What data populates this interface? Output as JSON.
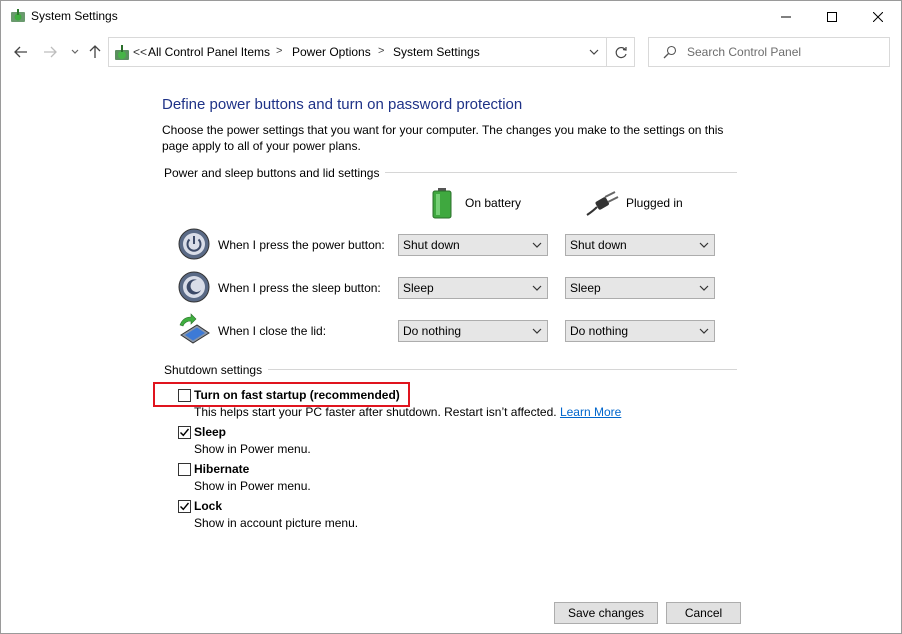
{
  "window": {
    "title": "System Settings",
    "controls": {
      "minimize": "minimize-icon",
      "maximize": "maximize-icon",
      "close": "close-icon"
    }
  },
  "nav": {
    "breadcrumb_overflow": "<<",
    "breadcrumbs": [
      "All Control Panel Items",
      "Power Options",
      "System Settings"
    ],
    "search_placeholder": "Search Control Panel"
  },
  "page": {
    "title": "Define power buttons and turn on password protection",
    "description": "Choose the power settings that you want for your computer. The changes you make to the settings on this page apply to all of your power plans."
  },
  "power_section": {
    "label": "Power and sleep buttons and lid settings",
    "columns": {
      "on_battery": "On battery",
      "plugged_in": "Plugged in"
    },
    "rows": [
      {
        "label": "When I press the power button:",
        "on_battery": "Shut down",
        "plugged_in": "Shut down",
        "icon": "power-button-icon"
      },
      {
        "label": "When I press the sleep button:",
        "on_battery": "Sleep",
        "plugged_in": "Sleep",
        "icon": "sleep-button-icon"
      },
      {
        "label": "When I close the lid:",
        "on_battery": "Do nothing",
        "plugged_in": "Do nothing",
        "icon": "laptop-lid-icon"
      }
    ]
  },
  "shutdown_section": {
    "label": "Shutdown settings",
    "options": [
      {
        "label": "Turn on fast startup (recommended)",
        "checked": false,
        "description": "This helps start your PC faster after shutdown. Restart isn’t affected.",
        "link": "Learn More"
      },
      {
        "label": "Sleep",
        "checked": true,
        "description": "Show in Power menu."
      },
      {
        "label": "Hibernate",
        "checked": false,
        "description": "Show in Power menu."
      },
      {
        "label": "Lock",
        "checked": true,
        "description": "Show in account picture menu."
      }
    ]
  },
  "footer": {
    "save": "Save changes",
    "cancel": "Cancel"
  },
  "colors": {
    "heading": "#1e3287",
    "link": "#0066cc",
    "highlight": "#e0141e"
  }
}
